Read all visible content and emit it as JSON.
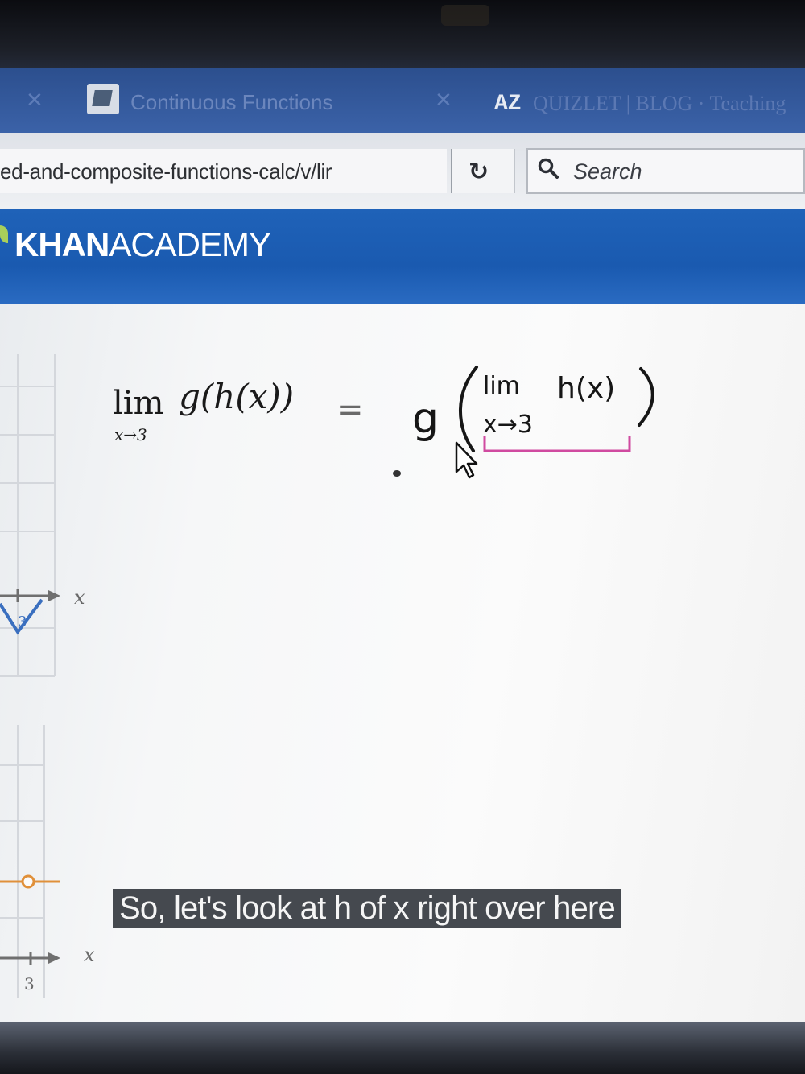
{
  "browser": {
    "tabs": [
      {
        "title": "Continuous Functions"
      },
      {
        "icon_text": "AZ",
        "title": "QUIZLET | BLOG · Teaching"
      }
    ],
    "address_bar": {
      "url_fragment": "ed-and-composite-functions-calc/v/lir"
    },
    "search": {
      "placeholder": "Search"
    }
  },
  "site": {
    "logo_bold": "KHAN",
    "logo_regular": "ACADEMY",
    "brand_color": "#1a5ab0"
  },
  "lesson": {
    "typed_equation": {
      "lim": "lim",
      "subscript": "x→3",
      "expression": "g(h(x))",
      "equals": "="
    },
    "handwritten": {
      "g": "g",
      "lim": "lim",
      "inner": "h(x)",
      "subscript": "x→3",
      "accent_color": "#d04aa0"
    },
    "graph_labels": {
      "axis_upper": "x",
      "tick_upper": "3",
      "axis_lower": "x",
      "tick_lower": "3"
    },
    "caption": "So, let's look at h of x right over here"
  }
}
